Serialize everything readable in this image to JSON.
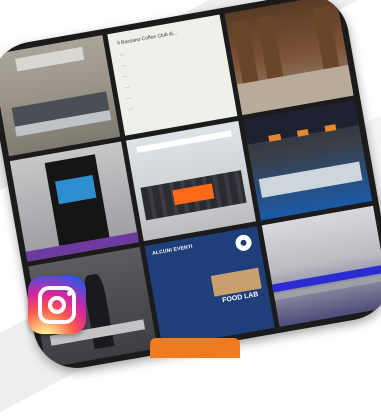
{
  "collage": {
    "post_lines": [
      "Il Bassano Coffee Club di... ",
      "...",
      "...",
      "...",
      "...",
      "...",
      "..."
    ],
    "flyer": {
      "lines": [
        "ALCUNI EVENTI",
        "",
        "",
        "",
        ""
      ],
      "lab_text": "FOOD LAB"
    }
  },
  "logo": {
    "name": "instagram-icon"
  },
  "colors": {
    "card": "#1b1b1b",
    "accent_orange": "#ff6a1a",
    "flyer_blue": "#1f3f7a"
  }
}
